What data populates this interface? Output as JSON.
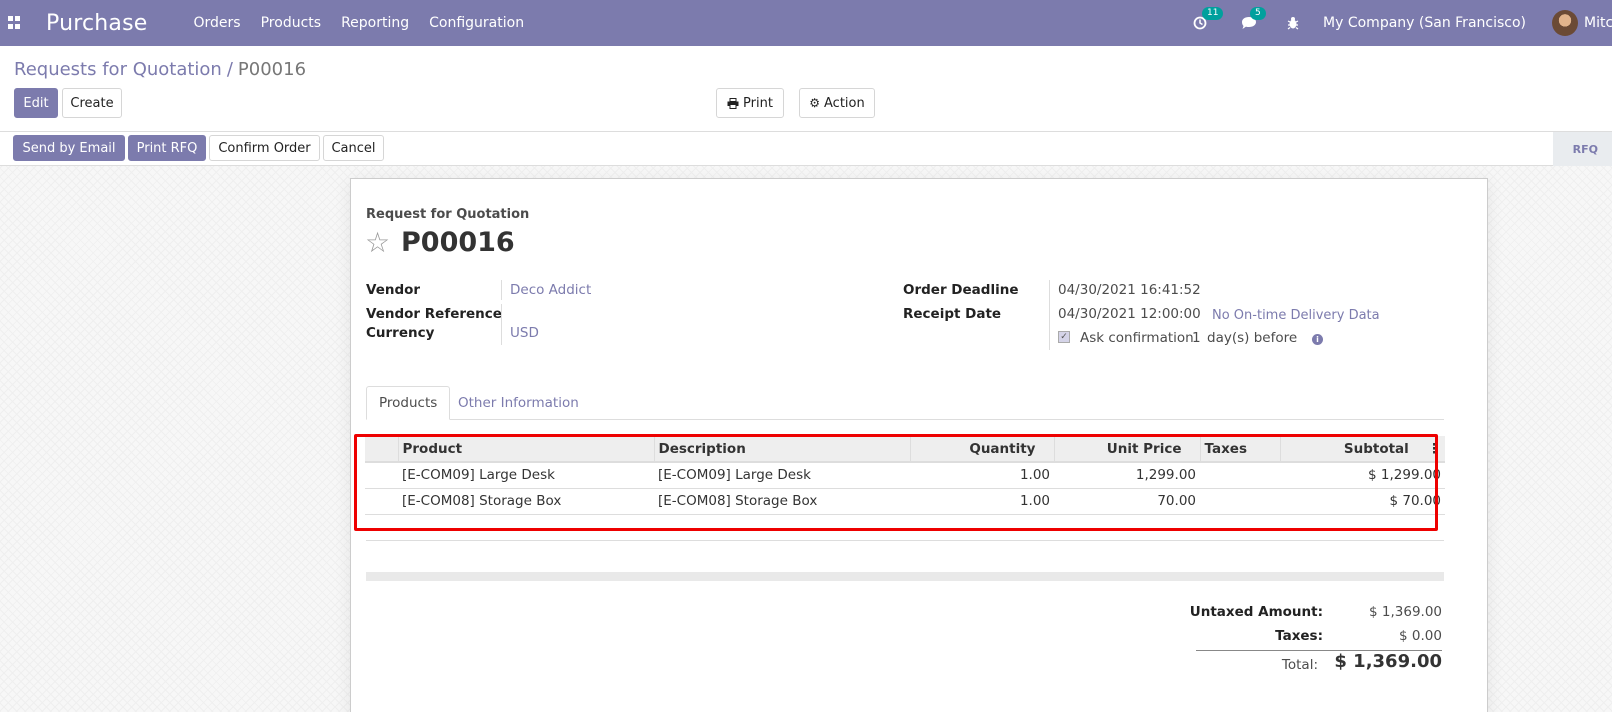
{
  "navbar": {
    "app_name": "Purchase",
    "menus": [
      "Orders",
      "Products",
      "Reporting",
      "Configuration"
    ],
    "activity_count": "11",
    "messages_count": "5",
    "company": "My Company (San Francisco)",
    "user": "Mitchell Admin"
  },
  "breadcrumb": {
    "parent": "Requests for Quotation",
    "separator": "/",
    "current": "P00016"
  },
  "control": {
    "edit_label": "Edit",
    "create_label": "Create",
    "print_label": "Print",
    "action_label": "Action"
  },
  "statusbar": {
    "send_email_label": "Send by Email",
    "print_rfq_label": "Print RFQ",
    "confirm_label": "Confirm Order",
    "cancel_label": "Cancel",
    "stage": "RFQ"
  },
  "form": {
    "doc_type": "Request for Quotation",
    "name": "P00016",
    "vendor_label": "Vendor",
    "vendor_value": "Deco Addict",
    "vendor_ref_label": "Vendor Reference",
    "vendor_ref_value": "",
    "currency_label": "Currency",
    "currency_value": "USD",
    "deadline_label": "Order Deadline",
    "deadline_value": "04/30/2021 16:41:52",
    "receipt_label": "Receipt Date",
    "receipt_value": "04/30/2021 12:00:00",
    "ontime_link": "No On-time Delivery Data",
    "ask_confirm_prefix": "Ask confirmation",
    "ask_confirm_days": "1",
    "ask_confirm_suffix": "day(s) before"
  },
  "tabs": [
    "Products",
    "Other Information"
  ],
  "table": {
    "headers": [
      "Product",
      "Description",
      "Quantity",
      "Unit Price",
      "Taxes",
      "Subtotal"
    ],
    "rows": [
      {
        "product": "[E-COM09] Large Desk",
        "description": "[E-COM09] Large Desk",
        "quantity": "1.00",
        "unit_price": "1,299.00",
        "taxes": "",
        "subtotal": "$ 1,299.00"
      },
      {
        "product": "[E-COM08] Storage Box",
        "description": "[E-COM08] Storage Box",
        "quantity": "1.00",
        "unit_price": "70.00",
        "taxes": "",
        "subtotal": "$ 70.00"
      }
    ]
  },
  "totals": {
    "untaxed_label": "Untaxed Amount:",
    "untaxed_value": "$ 1,369.00",
    "taxes_label": "Taxes:",
    "taxes_value": "$ 0.00",
    "total_label": "Total:",
    "total_value": "$ 1,369.00"
  }
}
